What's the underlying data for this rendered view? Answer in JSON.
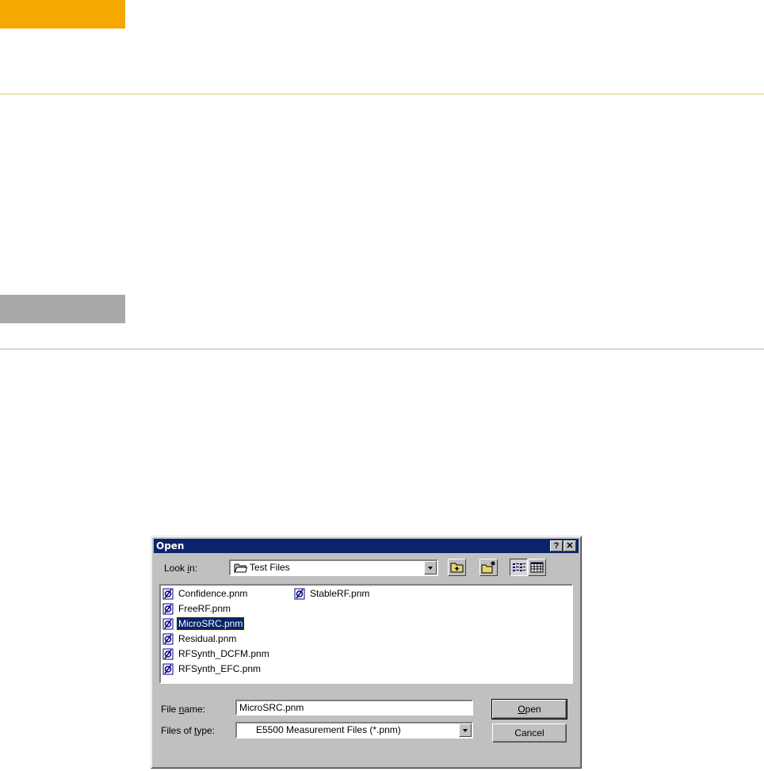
{
  "dialog": {
    "title": "Open",
    "help_button": "?",
    "close_button": "✕",
    "look_in": {
      "label_pre": "Look ",
      "label_key": "i",
      "label_post": "n:",
      "value": "Test Files"
    },
    "files": [
      {
        "name": "Confidence.pnm"
      },
      {
        "name": "FreeRF.pnm"
      },
      {
        "name": "MicroSRC.pnm",
        "selected": true
      },
      {
        "name": "Residual.pnm"
      },
      {
        "name": "RFSynth_DCFM.pnm"
      },
      {
        "name": "RFSynth_EFC.pnm"
      },
      {
        "name": "StableRF.pnm"
      }
    ],
    "file_name": {
      "label_pre": "File ",
      "label_key": "n",
      "label_post": "ame:",
      "value": "MicroSRC.pnm"
    },
    "file_type": {
      "label_pre": "Files of ",
      "label_key": "t",
      "label_post": "ype:",
      "value": "E5500 Measurement Files (*.pnm)"
    },
    "open_button": {
      "key": "O",
      "rest": "pen"
    },
    "cancel_button": "Cancel"
  },
  "colors": {
    "accent_tab": "#f5a800",
    "tab_gray": "#a8a8a8",
    "titlebar": "#0a246a",
    "selection": "#0a246a"
  }
}
